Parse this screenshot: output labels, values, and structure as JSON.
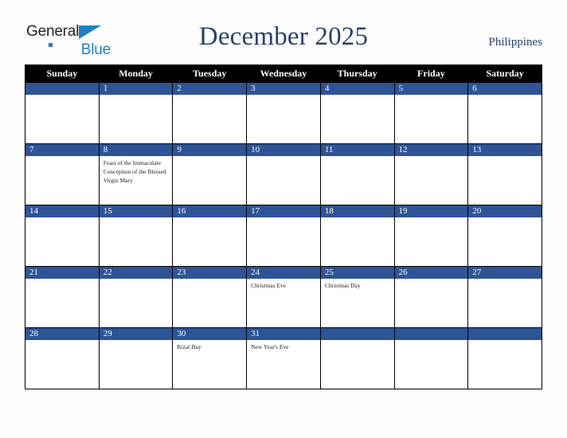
{
  "brand": {
    "name_part1": "General",
    "name_part2": "Blue",
    "accent_color": "#1f7fc4"
  },
  "header": {
    "title": "December 2025",
    "country": "Philippines",
    "title_color": "#29416b"
  },
  "calendar": {
    "weekday_headers": [
      "Sunday",
      "Monday",
      "Tuesday",
      "Wednesday",
      "Thursday",
      "Friday",
      "Saturday"
    ],
    "header_background": "#000000",
    "daynum_background": "#2e5496",
    "weeks": [
      [
        {
          "day": "",
          "events": ""
        },
        {
          "day": "1",
          "events": ""
        },
        {
          "day": "2",
          "events": ""
        },
        {
          "day": "3",
          "events": ""
        },
        {
          "day": "4",
          "events": ""
        },
        {
          "day": "5",
          "events": ""
        },
        {
          "day": "6",
          "events": ""
        }
      ],
      [
        {
          "day": "7",
          "events": ""
        },
        {
          "day": "8",
          "events": "Feast of the Immaculate Conception of the Blessed Virgin Mary"
        },
        {
          "day": "9",
          "events": ""
        },
        {
          "day": "10",
          "events": ""
        },
        {
          "day": "11",
          "events": ""
        },
        {
          "day": "12",
          "events": ""
        },
        {
          "day": "13",
          "events": ""
        }
      ],
      [
        {
          "day": "14",
          "events": ""
        },
        {
          "day": "15",
          "events": ""
        },
        {
          "day": "16",
          "events": ""
        },
        {
          "day": "17",
          "events": ""
        },
        {
          "day": "18",
          "events": ""
        },
        {
          "day": "19",
          "events": ""
        },
        {
          "day": "20",
          "events": ""
        }
      ],
      [
        {
          "day": "21",
          "events": ""
        },
        {
          "day": "22",
          "events": ""
        },
        {
          "day": "23",
          "events": ""
        },
        {
          "day": "24",
          "events": "Christmas Eve"
        },
        {
          "day": "25",
          "events": "Christmas Day"
        },
        {
          "day": "26",
          "events": ""
        },
        {
          "day": "27",
          "events": ""
        }
      ],
      [
        {
          "day": "28",
          "events": ""
        },
        {
          "day": "29",
          "events": ""
        },
        {
          "day": "30",
          "events": "Rizal Day"
        },
        {
          "day": "31",
          "events": "New Year's Eve"
        },
        {
          "day": "",
          "events": ""
        },
        {
          "day": "",
          "events": ""
        },
        {
          "day": "",
          "events": ""
        }
      ]
    ]
  }
}
